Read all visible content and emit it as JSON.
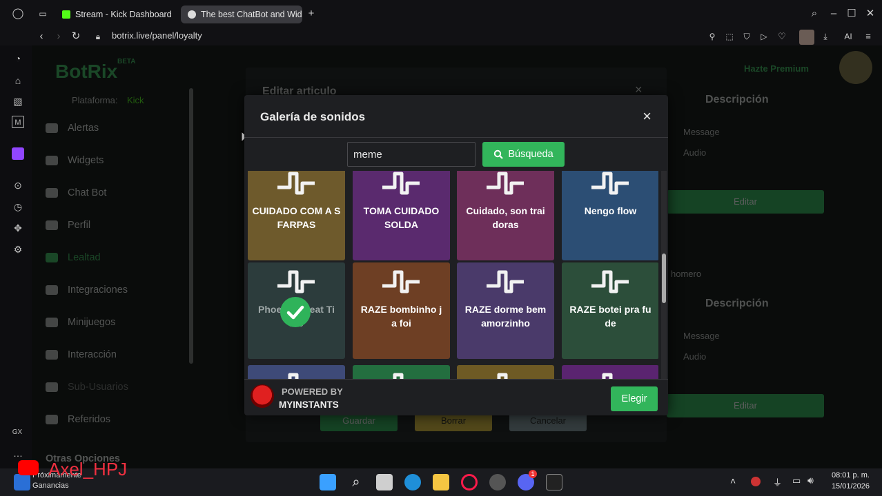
{
  "browser": {
    "tabs": [
      {
        "label": "Stream - Kick Dashboard",
        "active": false
      },
      {
        "label": "The best ChatBot and Wid",
        "active": true
      }
    ],
    "url": "botrix.live/panel/loyalty",
    "ai_label": "AI",
    "gx_label": "GX"
  },
  "background_page": {
    "logo": "BotRix",
    "beta": "BETA",
    "platform_label": "Plataforma:",
    "platform_value": "Kick",
    "premium": "Hazte Premium",
    "sidebar": [
      "Alertas",
      "Widgets",
      "Chat Bot",
      "Perfil",
      "Lealtad",
      "Integraciones",
      "Minijuegos",
      "Interacción",
      "Sub-Usuarios",
      "Referidos",
      "Otras Opciones"
    ],
    "edit_modal_title": "Editar articulo",
    "descripcion": "Descripción",
    "message": "Message",
    "audio": "Audio",
    "editar": "Editar",
    "homero": "homero",
    "guardar": "Guardar",
    "borrar": "Borrar",
    "cancelar": "Cancelar"
  },
  "modal": {
    "title": "Galería de sonidos",
    "close": "×",
    "search_value": "meme",
    "search_button": "Búsqueda",
    "sounds": [
      {
        "label": "CUIDADO COM A S FARPAS",
        "color": "#6e5a2c"
      },
      {
        "label": "TOMA CUIDADO SOLDA",
        "color": "#5a2a6e"
      },
      {
        "label": "Cuidado, son trai doras",
        "color": "#6e2f5a"
      },
      {
        "label": "Nengo flow",
        "color": "#2c4e74"
      },
      {
        "label": "Phoenix Great Ti me",
        "color": "#2c3c3c",
        "selected": true
      },
      {
        "label": "RAZE bombinho j a foi",
        "color": "#6e3f24"
      },
      {
        "label": "RAZE dorme bem amorzinho",
        "color": "#4a3a6a"
      },
      {
        "label": "RAZE botei pra fu de",
        "color": "#2c4e3a"
      },
      {
        "label": "",
        "color": "#3e4a78"
      },
      {
        "label": "",
        "color": "#236e3f"
      },
      {
        "label": "",
        "color": "#6e5a24"
      },
      {
        "label": "",
        "color": "#5a2470"
      }
    ],
    "powered_by": "POWERED BY",
    "provider": "MYINSTANTS",
    "choose_button": "Elegir"
  },
  "taskbar": {
    "overlay_name": "Axel_HPJ",
    "widget_line1": "Próximamente",
    "widget_line2": "Ganancias",
    "time": "08:01 p. m.",
    "date": "15/01/2026",
    "discord_badge": "1"
  }
}
